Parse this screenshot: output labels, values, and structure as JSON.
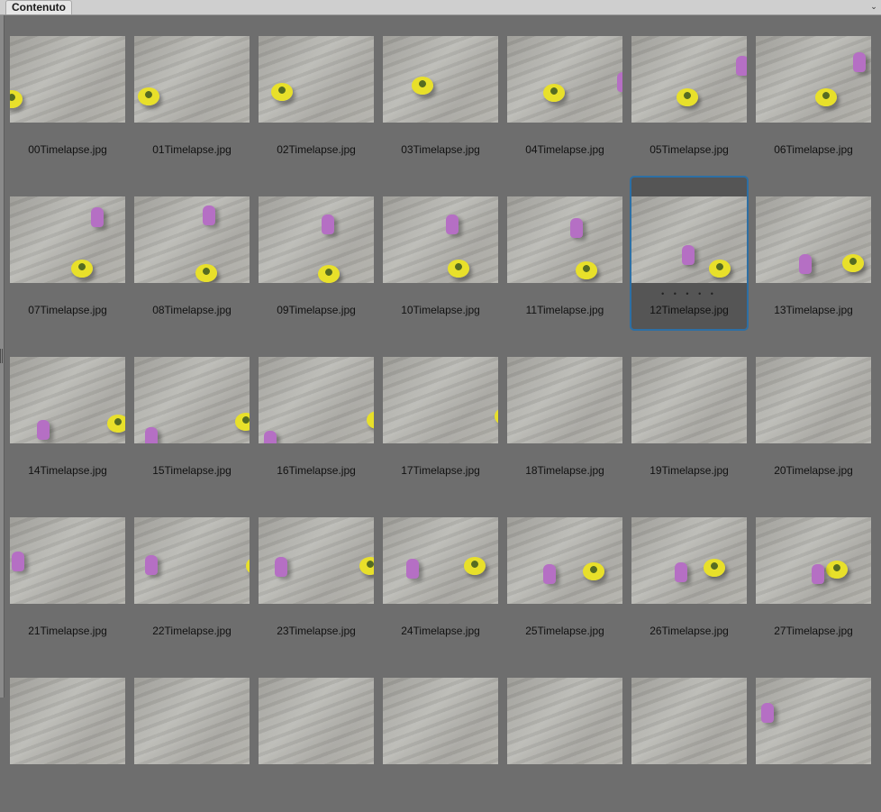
{
  "panel": {
    "tab_label": "Contenuto",
    "menu_icon": "chevron-down-icon"
  },
  "selected_index": 12,
  "items": [
    {
      "label": "00Timelapse.jpg"
    },
    {
      "label": "01Timelapse.jpg"
    },
    {
      "label": "02Timelapse.jpg"
    },
    {
      "label": "03Timelapse.jpg"
    },
    {
      "label": "04Timelapse.jpg"
    },
    {
      "label": "05Timelapse.jpg"
    },
    {
      "label": "06Timelapse.jpg"
    },
    {
      "label": "07Timelapse.jpg"
    },
    {
      "label": "08Timelapse.jpg"
    },
    {
      "label": "09Timelapse.jpg"
    },
    {
      "label": "10Timelapse.jpg"
    },
    {
      "label": "11Timelapse.jpg"
    },
    {
      "label": "12Timelapse.jpg"
    },
    {
      "label": "13Timelapse.jpg"
    },
    {
      "label": "14Timelapse.jpg"
    },
    {
      "label": "15Timelapse.jpg"
    },
    {
      "label": "16Timelapse.jpg"
    },
    {
      "label": "17Timelapse.jpg"
    },
    {
      "label": "18Timelapse.jpg"
    },
    {
      "label": "19Timelapse.jpg"
    },
    {
      "label": "20Timelapse.jpg"
    },
    {
      "label": "21Timelapse.jpg"
    },
    {
      "label": "22Timelapse.jpg"
    },
    {
      "label": "23Timelapse.jpg"
    },
    {
      "label": "24Timelapse.jpg"
    },
    {
      "label": "25Timelapse.jpg"
    },
    {
      "label": "26Timelapse.jpg"
    },
    {
      "label": "27Timelapse.jpg"
    },
    {
      "label": ""
    },
    {
      "label": ""
    },
    {
      "label": ""
    },
    {
      "label": ""
    },
    {
      "label": ""
    },
    {
      "label": ""
    },
    {
      "label": ""
    }
  ],
  "selected_rating_dots": "• • • • •",
  "colors": {
    "panel_bg": "#6e6e6e",
    "selection_border": "#2d6fa4",
    "ball": "#e8e02a",
    "figure": "#b56fc4"
  }
}
